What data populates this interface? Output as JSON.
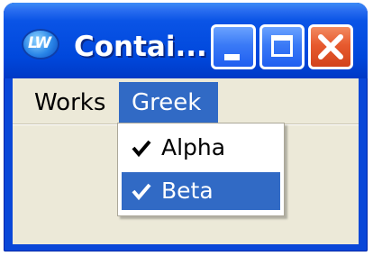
{
  "window": {
    "title": "Contai...",
    "app_icon": {
      "name": "lw-app-icon",
      "text": "LW"
    },
    "controls": [
      {
        "name": "minimize",
        "icon": "minimize-icon"
      },
      {
        "name": "maximize",
        "icon": "maximize-icon"
      },
      {
        "name": "close",
        "icon": "close-icon"
      }
    ]
  },
  "menubar": {
    "items": [
      {
        "label": "Works",
        "open": false
      },
      {
        "label": "Greek",
        "open": true
      }
    ]
  },
  "dropdown": {
    "items": [
      {
        "label": "Alpha",
        "checked": true,
        "highlighted": false,
        "icon": "checkmark-icon"
      },
      {
        "label": "Beta",
        "checked": true,
        "highlighted": true,
        "icon": "checkmark-icon"
      }
    ]
  },
  "colors": {
    "titlebar": "#0054e3",
    "close_button": "#e75a2e",
    "menu_highlight": "#316ac5",
    "client_background": "#ece9d8"
  }
}
